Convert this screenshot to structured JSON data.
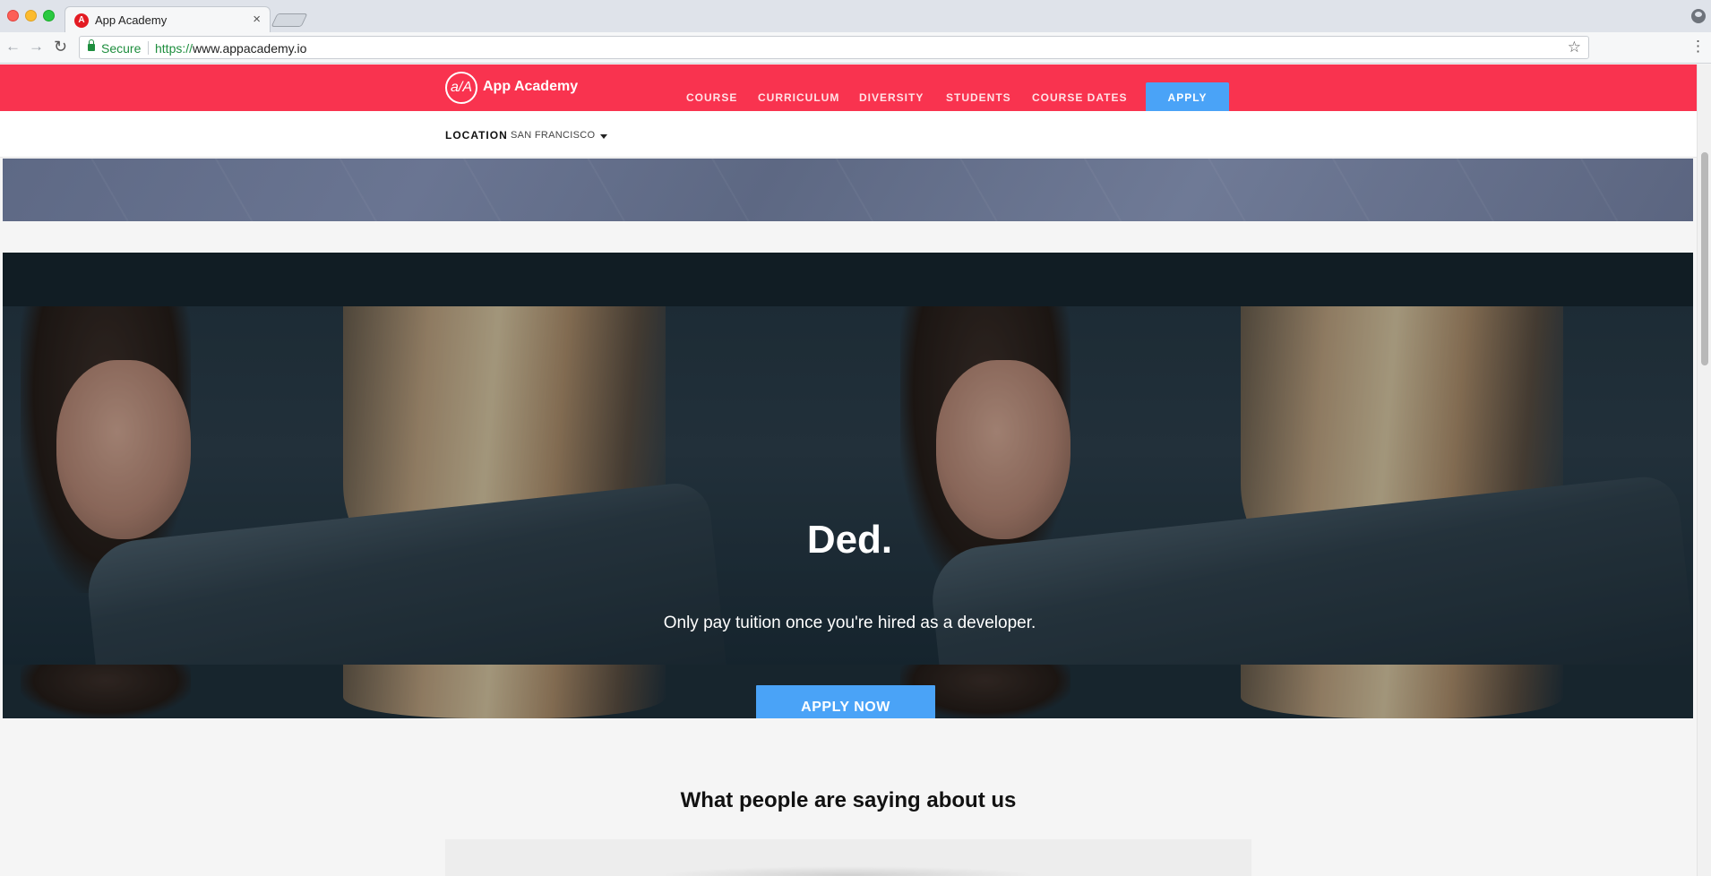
{
  "browser": {
    "tab_title": "App Academy",
    "tab_close": "×",
    "favicon_letter": "A",
    "secure_label": "Secure",
    "url_scheme": "https://",
    "url_host": "www.appacademy.io"
  },
  "header": {
    "logo_mark": "a/A",
    "logo_text": "App Academy",
    "nav": [
      "COURSE",
      "CURRICULUM",
      "DIVERSITY",
      "STUDENTS",
      "COURSE DATES"
    ],
    "apply_label": "APPLY",
    "brand_color": "#f9334f",
    "accent_color": "#4aa3f7"
  },
  "location": {
    "label": "LOCATION",
    "value": "SAN FRANCISCO"
  },
  "hero": {
    "title": "Ded.",
    "subtitle": "Only pay tuition once you're hired as a developer.",
    "cta_label": "APPLY NOW"
  },
  "testimonials": {
    "title": "What people are saying about us"
  }
}
